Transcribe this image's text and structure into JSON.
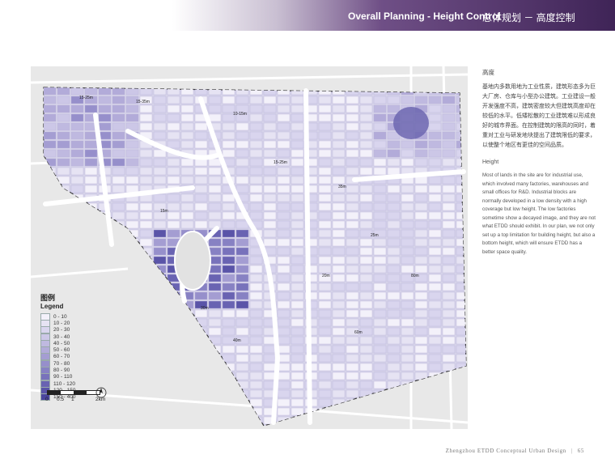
{
  "header": {
    "title_en": "Overall Planning - Height Control",
    "title_cn": "总体规划 － 高度控制"
  },
  "legend": {
    "title_cn": "图例",
    "title_en": "Legend",
    "items": [
      {
        "label": "0 - 10",
        "color": "#f3f1fa"
      },
      {
        "label": "10 - 20",
        "color": "#e6e3f3"
      },
      {
        "label": "20 - 30",
        "color": "#d9d5ee"
      },
      {
        "label": "30 - 40",
        "color": "#ccc7e7"
      },
      {
        "label": "40 - 50",
        "color": "#bfb9e0"
      },
      {
        "label": "50 - 60",
        "color": "#b2abd9"
      },
      {
        "label": "60 - 70",
        "color": "#a49dd2"
      },
      {
        "label": "70 - 80",
        "color": "#968fcb"
      },
      {
        "label": "80 - 90",
        "color": "#8781c3"
      },
      {
        "label": "90 - 110",
        "color": "#7872bb"
      },
      {
        "label": "110 - 120",
        "color": "#6963b2"
      },
      {
        "label": "120 - 150",
        "color": "#5a54a8"
      },
      {
        "label": "150 - 400",
        "color": "#4a459d"
      }
    ]
  },
  "scale": {
    "ticks": [
      "0",
      "0.5",
      "1",
      "2km"
    ]
  },
  "map_labels": [
    "15-25m",
    "15-35m",
    "10-15m",
    "15-25m",
    "35m",
    "25m",
    "20m",
    "30m",
    "40m",
    "60m",
    "80m",
    "15m"
  ],
  "text": {
    "heading_cn": "高度",
    "para_cn": "基地内多数用地为工业性质，建筑形态多为巨大厂房、仓库与小型办公建筑。工业建设一般开发强度不高，建筑密度较大但建筑高度却在较低的水平。低矮松散的工业建筑难以形成良好的城市界面。在控制建筑的限高的同时，着重对工业与研发地块提出了建筑限低的要求，以使整个地区有更佳的空间品质。",
    "heading_en": "Height",
    "para_en": "Most of lands in the site are for industrial use, which involved many factories, warehouses and small offices for R&D. Industrial blocks are normally developed in a low density with a high coverage but low height. The low factories sometime show a decayed image, and they are not what ETDD should exhibit. In our plan, we not only set up a top limitation for building height, but also a bottom height, which will ensure ETDD has a better space quality."
  },
  "footer": {
    "project": "Zhengzhou ETDD Conceptual Urban Design",
    "page": "65"
  }
}
